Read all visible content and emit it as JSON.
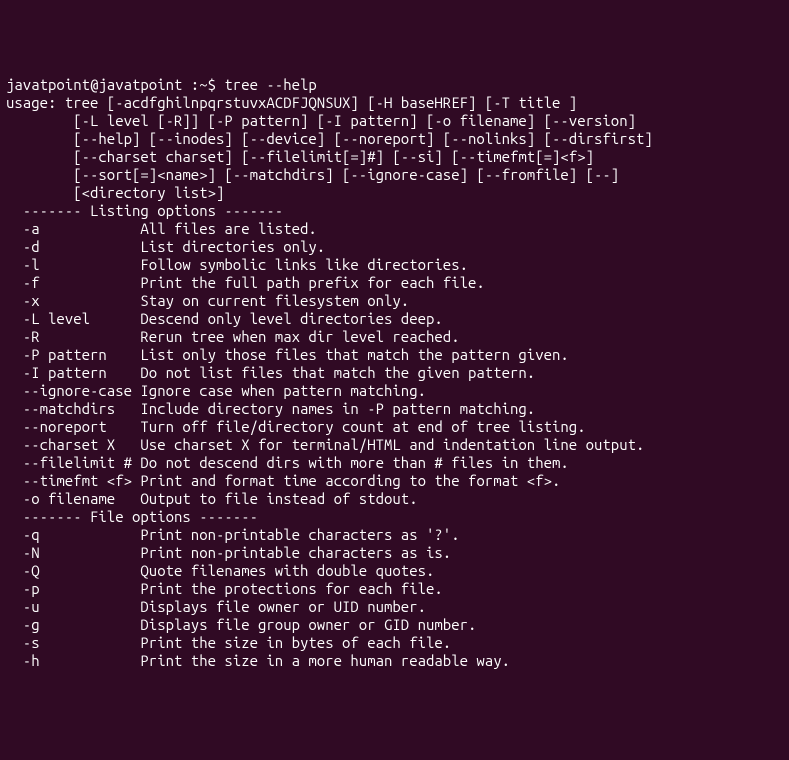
{
  "prompt": "javatpoint@javatpoint :~$ ",
  "command": "tree --help",
  "usage_lines": [
    "usage: tree [-acdfghilnpqrstuvxACDFJQNSUX] [-H baseHREF] [-T title ]",
    "\t[-L level [-R]] [-P pattern] [-I pattern] [-o filename] [--version]",
    "\t[--help] [--inodes] [--device] [--noreport] [--nolinks] [--dirsfirst]",
    "\t[--charset charset] [--filelimit[=]#] [--si] [--timefmt[=]<f>]",
    "\t[--sort[=]<name>] [--matchdirs] [--ignore-case] [--fromfile] [--]",
    "\t[<directory list>]"
  ],
  "sections": [
    {
      "header": "  ------- Listing options -------",
      "options": [
        {
          "flag": "  -a            ",
          "desc": "All files are listed."
        },
        {
          "flag": "  -d            ",
          "desc": "List directories only."
        },
        {
          "flag": "  -l            ",
          "desc": "Follow symbolic links like directories."
        },
        {
          "flag": "  -f            ",
          "desc": "Print the full path prefix for each file."
        },
        {
          "flag": "  -x            ",
          "desc": "Stay on current filesystem only."
        },
        {
          "flag": "  -L level      ",
          "desc": "Descend only level directories deep."
        },
        {
          "flag": "  -R            ",
          "desc": "Rerun tree when max dir level reached."
        },
        {
          "flag": "  -P pattern    ",
          "desc": "List only those files that match the pattern given."
        },
        {
          "flag": "  -I pattern    ",
          "desc": "Do not list files that match the given pattern."
        },
        {
          "flag": "  --ignore-case ",
          "desc": "Ignore case when pattern matching."
        },
        {
          "flag": "  --matchdirs   ",
          "desc": "Include directory names in -P pattern matching."
        },
        {
          "flag": "  --noreport    ",
          "desc": "Turn off file/directory count at end of tree listing."
        },
        {
          "flag": "  --charset X   ",
          "desc": "Use charset X for terminal/HTML and indentation line output."
        },
        {
          "flag": "  --filelimit # ",
          "desc": "Do not descend dirs with more than # files in them."
        },
        {
          "flag": "  --timefmt <f> ",
          "desc": "Print and format time according to the format <f>."
        },
        {
          "flag": "  -o filename   ",
          "desc": "Output to file instead of stdout."
        }
      ]
    },
    {
      "header": "  ------- File options -------",
      "options": [
        {
          "flag": "  -q            ",
          "desc": "Print non-printable characters as '?'."
        },
        {
          "flag": "  -N            ",
          "desc": "Print non-printable characters as is."
        },
        {
          "flag": "  -Q            ",
          "desc": "Quote filenames with double quotes."
        },
        {
          "flag": "  -p            ",
          "desc": "Print the protections for each file."
        },
        {
          "flag": "  -u            ",
          "desc": "Displays file owner or UID number."
        },
        {
          "flag": "  -g            ",
          "desc": "Displays file group owner or GID number."
        },
        {
          "flag": "  -s            ",
          "desc": "Print the size in bytes of each file."
        },
        {
          "flag": "  -h            ",
          "desc": "Print the size in a more human readable way."
        }
      ]
    }
  ]
}
